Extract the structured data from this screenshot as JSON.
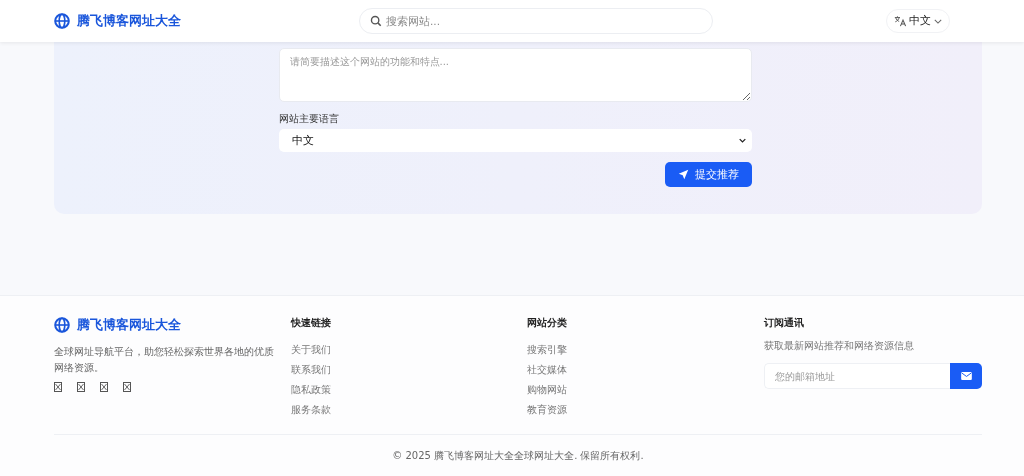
{
  "header": {
    "brand": "腾飞博客网址大全",
    "search": {
      "placeholder": "搜索网站..."
    },
    "language": "中文"
  },
  "form": {
    "description": {
      "placeholder": "请简要描述这个网站的功能和特点..."
    },
    "language_label": "网站主要语言",
    "language_select": {
      "value": "中文"
    },
    "submit": "提交推荐"
  },
  "footer": {
    "brand": "腾飞博客网址大全",
    "about": "全球网址导航平台，助您轻松探索世界各地的优质网络资源。",
    "columns": [
      {
        "title": "快速链接",
        "links": [
          "关于我们",
          "联系我们",
          "隐私政策",
          "服务条款"
        ]
      },
      {
        "title": "网站分类",
        "links": [
          "搜索引擎",
          "社交媒体",
          "购物网站",
          "教育资源"
        ]
      }
    ],
    "newsletter": {
      "title": "订阅通讯",
      "text": "获取最新网站推荐和网络资源信息",
      "email": {
        "placeholder": "您的邮箱地址"
      }
    },
    "copyright": "© 2025 腾飞博客网址大全全球网址大全. 保留所有权利."
  }
}
